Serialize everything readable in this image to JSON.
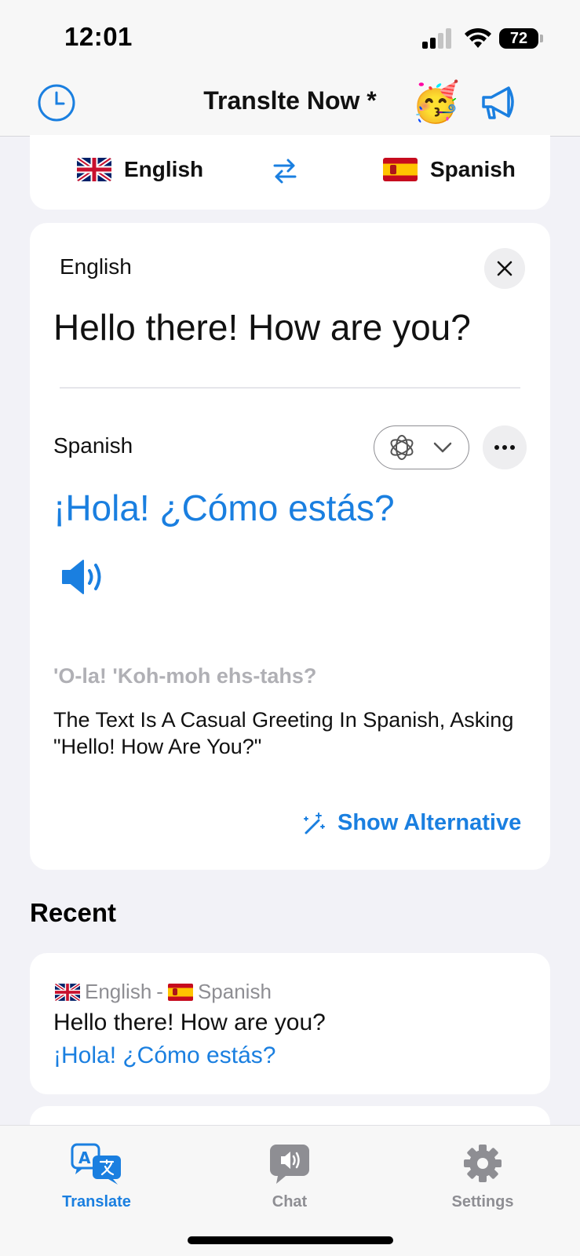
{
  "status_bar": {
    "time": "12:01",
    "battery": "72"
  },
  "nav": {
    "title": "Translte Now *",
    "emoji": "🥳"
  },
  "languages": {
    "source": "English",
    "target": "Spanish"
  },
  "translation": {
    "source_label": "English",
    "source_text": "Hello there! How are you?",
    "target_label": "Spanish",
    "target_text": "¡Hola! ¿Cómo estás?",
    "pronunciation": "'O-la! 'Koh-moh ehs-tahs?",
    "explanation": "The Text Is A Casual Greeting In Spanish, Asking \"Hello! How Are You?\"",
    "show_alternative": "Show Alternative"
  },
  "recent": {
    "title": "Recent",
    "items": [
      {
        "source_lang": "English",
        "separator": "-",
        "target_lang": "Spanish",
        "source_text": "Hello there! How are you?",
        "target_text": "¡Hola! ¿Cómo estás?"
      }
    ]
  },
  "tabs": [
    {
      "label": "Translate",
      "active": true
    },
    {
      "label": "Chat",
      "active": false
    },
    {
      "label": "Settings",
      "active": false
    }
  ],
  "colors": {
    "accent": "#1a7fe0",
    "inactive": "#8e8e93",
    "background": "#f2f2f7"
  }
}
